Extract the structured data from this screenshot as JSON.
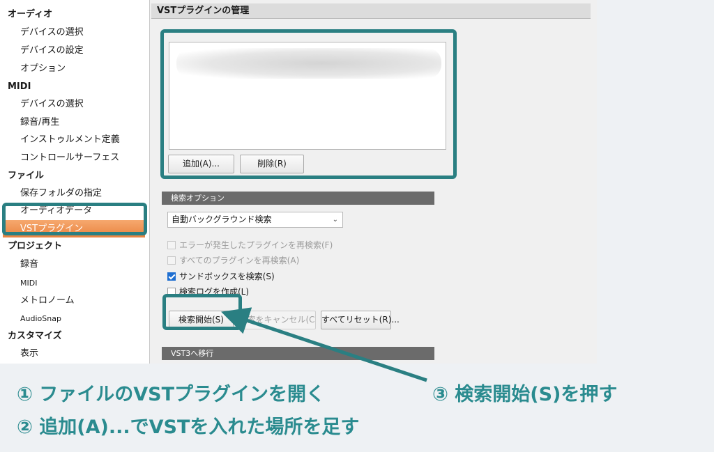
{
  "sidebar": {
    "items": [
      {
        "label": "オーディオ",
        "kind": "category"
      },
      {
        "label": "デバイスの選択",
        "kind": "sub"
      },
      {
        "label": "デバイスの設定",
        "kind": "sub"
      },
      {
        "label": "オプション",
        "kind": "sub"
      },
      {
        "label": "MIDI",
        "kind": "category"
      },
      {
        "label": "デバイスの選択",
        "kind": "sub"
      },
      {
        "label": "録音/再生",
        "kind": "sub"
      },
      {
        "label": "インストゥルメント定義",
        "kind": "sub"
      },
      {
        "label": "コントロールサーフェス",
        "kind": "sub"
      },
      {
        "label": "ファイル",
        "kind": "category"
      },
      {
        "label": "保存フォルダの指定",
        "kind": "sub"
      },
      {
        "label": "オーディオデータ",
        "kind": "sub"
      },
      {
        "label": "VSTプラグイン",
        "kind": "selected"
      },
      {
        "label": "プロジェクト",
        "kind": "category"
      },
      {
        "label": "録音",
        "kind": "sub"
      },
      {
        "label": "MIDI",
        "kind": "small"
      },
      {
        "label": "メトロノーム",
        "kind": "sub"
      },
      {
        "label": "AudioSnap",
        "kind": "small"
      },
      {
        "label": "カスタマイズ",
        "kind": "category"
      },
      {
        "label": "表示",
        "kind": "sub"
      }
    ]
  },
  "main": {
    "title": "VSTプラグインの管理",
    "add_button": "追加(A)...",
    "remove_button": "削除(R)",
    "search_options_header": "検索オプション",
    "scan_mode": "自動バックグラウンド検索",
    "options": [
      {
        "label": "エラーが発生したプラグインを再検索(F)",
        "checked": false,
        "enabled": false
      },
      {
        "label": "すべてのプラグインを再検索(A)",
        "checked": false,
        "enabled": false
      },
      {
        "label": "サンドボックスを検索(S)",
        "checked": true,
        "enabled": true
      },
      {
        "label": "検索ログを作成(L)",
        "checked": false,
        "enabled": true
      }
    ],
    "start_scan_button": "検索開始(S)",
    "cancel_scan_button": "検索をキャンセル(C",
    "reset_all_button": "すべてリセット(R)...",
    "vst3_header": "VST3へ移行"
  },
  "annotations": {
    "step1": "① ファイルのVSTプラグインを開く",
    "step2": "② 追加(A)...でVSTを入れた場所を足す",
    "step3": "③ 検索開始(S)を押す",
    "highlight_color": "#2a7f82",
    "text_color": "#2a8b8f"
  }
}
